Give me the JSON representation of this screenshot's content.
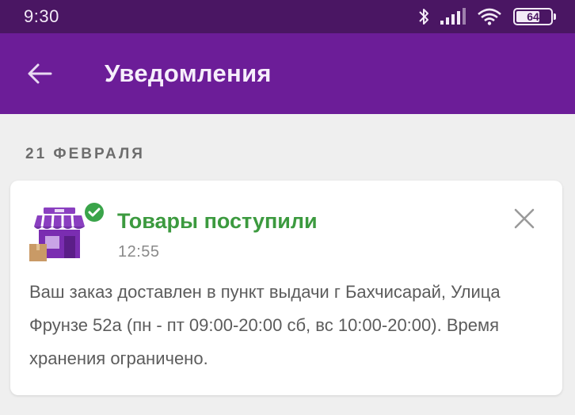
{
  "status_bar": {
    "time": "9:30",
    "battery": "64",
    "battery_level_percent": 64,
    "icons": [
      "bluetooth-icon",
      "signal-icon",
      "wifi-icon",
      "battery-icon"
    ]
  },
  "app_bar": {
    "title": "Уведомления",
    "back_icon": "arrow-left-icon"
  },
  "notifications": {
    "date_label": "21 ФЕВРАЛЯ",
    "items": [
      {
        "title": "Товары поступили",
        "time": "12:55",
        "body": "Ваш заказ доставлен в пункт выдачи г Бахчисарай, Улица Фрунзе 52а (пн - пт 09:00-20:00 сб, вс 10:00-20:00). Время хранения ограничено.",
        "icon": "pickup-point-store-icon",
        "badge_icon": "check-circle-icon",
        "close_icon": "close-icon"
      }
    ]
  },
  "colors": {
    "status_bar": "#4a1663",
    "app_bar": "#6c1d98",
    "title_green": "#3c9a3f",
    "background": "#efefef"
  }
}
